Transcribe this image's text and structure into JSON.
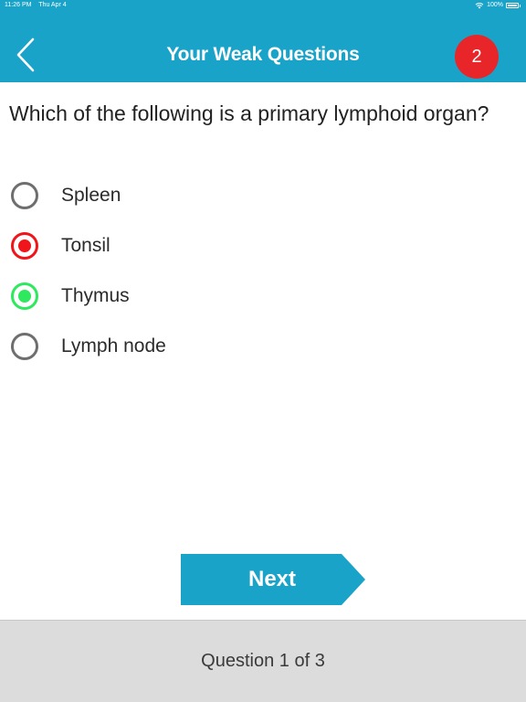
{
  "status_bar": {
    "time": "11:26 PM",
    "date": "Thu Apr 4",
    "battery": "100%"
  },
  "header": {
    "title": "Your Weak Questions",
    "badge_count": "2"
  },
  "question": {
    "text": "Which of the following is a primary lymphoid organ?",
    "options": [
      {
        "label": "Spleen",
        "state": "unselected"
      },
      {
        "label": "Tonsil",
        "state": "wrong"
      },
      {
        "label": "Thymus",
        "state": "correct"
      },
      {
        "label": "Lymph node",
        "state": "unselected"
      }
    ]
  },
  "next_button": {
    "label": "Next"
  },
  "footer": {
    "progress": "Question 1 of 3"
  },
  "colors": {
    "primary": "#1aa3c9",
    "badge": "#e8262a",
    "wrong": "#f0151b",
    "correct": "#2ee85e",
    "footer_bg": "#dcdcdc"
  }
}
